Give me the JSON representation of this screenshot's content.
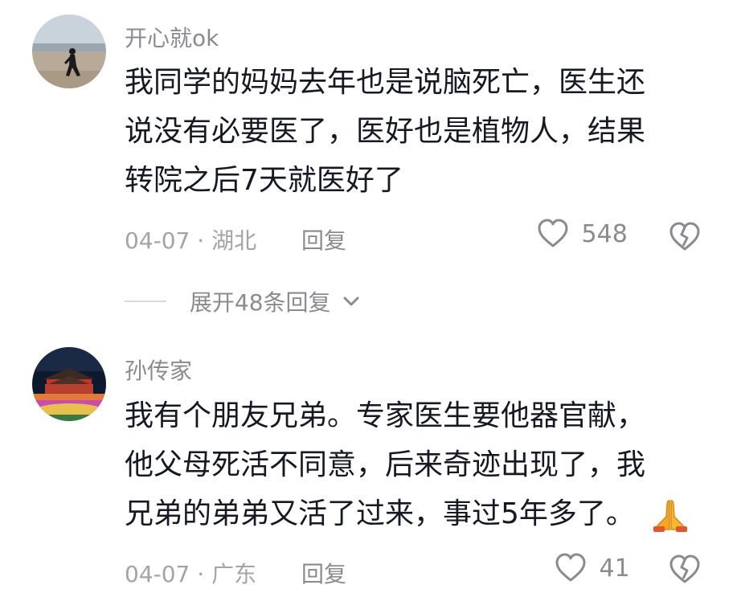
{
  "comments": [
    {
      "username": "开心就ok",
      "lines": [
        "我同学的妈妈去年也是说脑死亡，医生还",
        "说没有必要医了，医好也是植物人，结果",
        "转院之后7天就医好了"
      ],
      "date_location": "04-07 · 湖北",
      "reply_label": "回复",
      "likes": "548",
      "expand_label": "展开48条回复"
    },
    {
      "username": "孙传家",
      "lines": [
        "我有个朋友兄弟。专家医生要他器官献，",
        "他父母死活不同意，后来奇迹出现了，我",
        "兄弟的弟弟又活了过来，事过5年多了。"
      ],
      "date_location": "04-07 · 广东",
      "reply_label": "回复",
      "likes": "41",
      "emoji": "praying-hands"
    }
  ],
  "colors": {
    "text": "#161823",
    "secondary": "#8a8b91",
    "meta": "#a3a4a8"
  }
}
